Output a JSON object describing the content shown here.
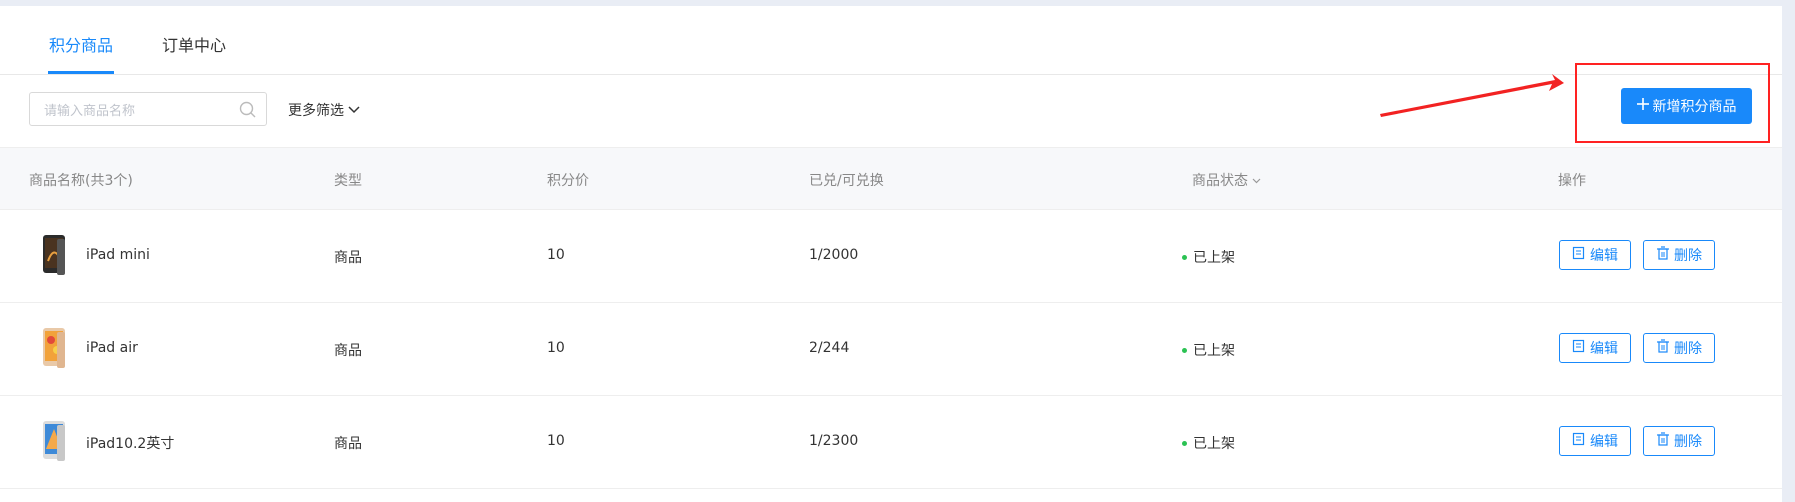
{
  "tabs": [
    {
      "label": "积分商品",
      "active": true
    },
    {
      "label": "订单中心",
      "active": false
    }
  ],
  "toolbar": {
    "search_placeholder": "请输入商品名称",
    "more_filter_label": "更多筛选",
    "add_button_label": "新增积分商品"
  },
  "table": {
    "headers": [
      "商品名称(共3个)",
      "类型",
      "积分价",
      "已兑/可兑换",
      "商品状态",
      "操作"
    ],
    "rows": [
      {
        "name": "iPad mini",
        "type": "商品",
        "points": "10",
        "redeemed": "1/2000",
        "status": "已上架"
      },
      {
        "name": "iPad air",
        "type": "商品",
        "points": "10",
        "redeemed": "2/244",
        "status": "已上架"
      },
      {
        "name": "iPad10.2英寸",
        "type": "商品",
        "points": "10",
        "redeemed": "1/2300",
        "status": "已上架"
      }
    ],
    "edit_label": "编辑",
    "delete_label": "删除"
  },
  "colors": {
    "primary": "#1989fa",
    "status_on": "#2bc253",
    "annotation": "#f22222"
  }
}
